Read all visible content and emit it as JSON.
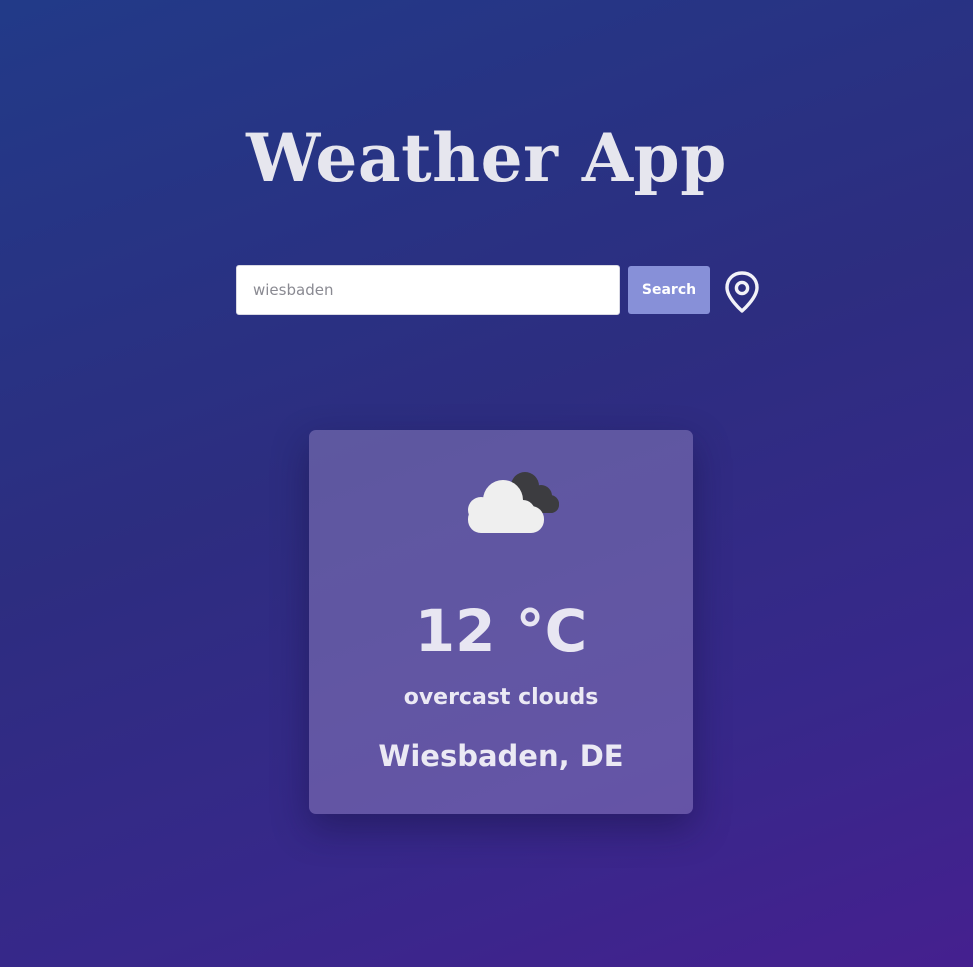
{
  "header": {
    "title": "Weather App"
  },
  "search": {
    "value": "",
    "placeholder": "wiesbaden",
    "button_label": "Search",
    "location_icon": "map-pin-icon"
  },
  "weather": {
    "icon": "overcast-clouds-icon",
    "temperature": "12 °C",
    "description": "overcast clouds",
    "location": "Wiesbaden, DE"
  },
  "colors": {
    "background_start": "#223a88",
    "background_end": "#45208f",
    "button": "#8790d8",
    "card": "#6c5fa3",
    "text": "#e8e6f2"
  }
}
